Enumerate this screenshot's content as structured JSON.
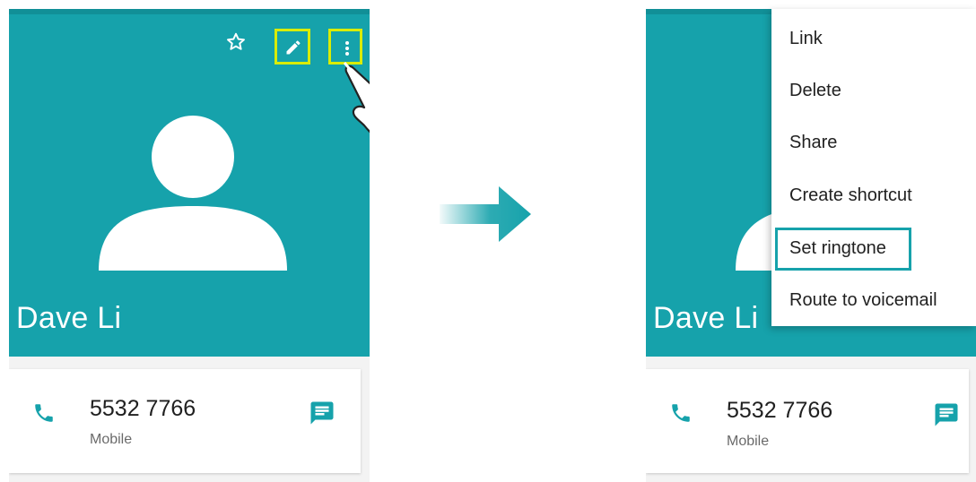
{
  "contact": {
    "name": "Dave Li",
    "phone_number": "5532 7766",
    "phone_type": "Mobile"
  },
  "icons": {
    "star": "star-outline-icon",
    "edit": "pencil-icon",
    "more": "more-vertical-icon",
    "phone": "phone-icon",
    "message": "message-icon",
    "avatar": "person-placeholder-icon",
    "cursor": "hand-pointer-icon",
    "arrow": "arrow-right-icon"
  },
  "menu": {
    "items": [
      {
        "label": "Link"
      },
      {
        "label": "Delete"
      },
      {
        "label": "Share"
      },
      {
        "label": "Create shortcut"
      },
      {
        "label": "Set ringtone",
        "highlighted": true
      },
      {
        "label": "Route to voicemail"
      }
    ]
  },
  "colors": {
    "header": "#16a2ab",
    "highlight_action": "#d9ec00",
    "highlight_menu": "#16a2ab"
  }
}
